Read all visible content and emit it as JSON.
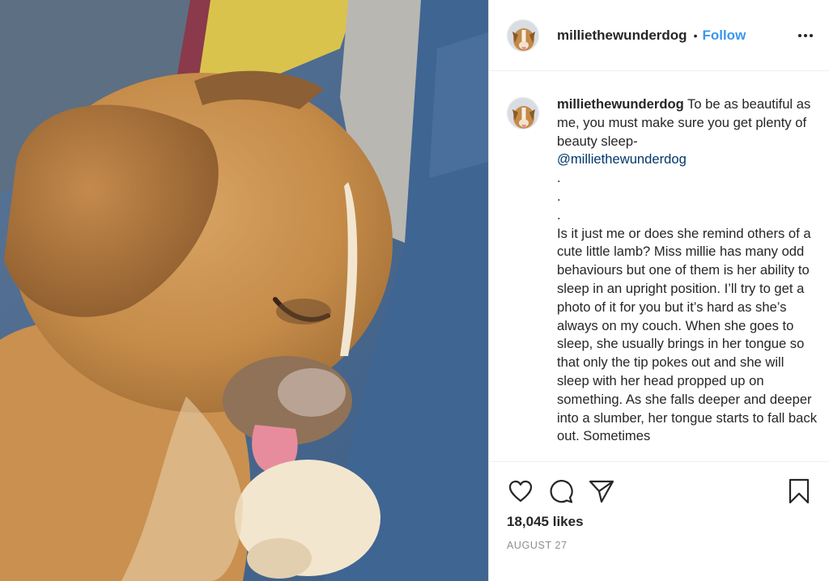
{
  "post": {
    "username": "milliethewunderdog",
    "separator": "•",
    "follow_label": "Follow",
    "more_icon": "more-options-icon",
    "caption": {
      "username": "milliethewunderdog",
      "lines": [
        "To be as beautiful as me, you must make sure you get plenty of beauty sleep-",
        ".",
        ".",
        ".",
        "Is it just me or does she remind others of a cute little lamb? Miss millie has many odd behaviours but one of them is her ability to sleep in an upright position. I’ll try to get a photo of it for you but it’s hard as she’s always on my couch. When she goes to sleep, she usually brings in her tongue so that only the tip pokes out and she will sleep with her head propped up on something. As she falls deeper and deeper into a slumber, her tongue starts to fall back out. Sometimes"
      ],
      "mention": "@milliethewunderdog"
    },
    "actions": {
      "like_icon": "heart-icon",
      "comment_icon": "comment-icon",
      "share_icon": "share-icon",
      "save_icon": "bookmark-icon"
    },
    "likes": "18,045 likes",
    "date": "AUGUST 27"
  },
  "colors": {
    "follow": "#3897f0",
    "mention": "#00376b",
    "text": "#262626",
    "muted": "#8e8e8e",
    "border": "#dbdbdb"
  }
}
